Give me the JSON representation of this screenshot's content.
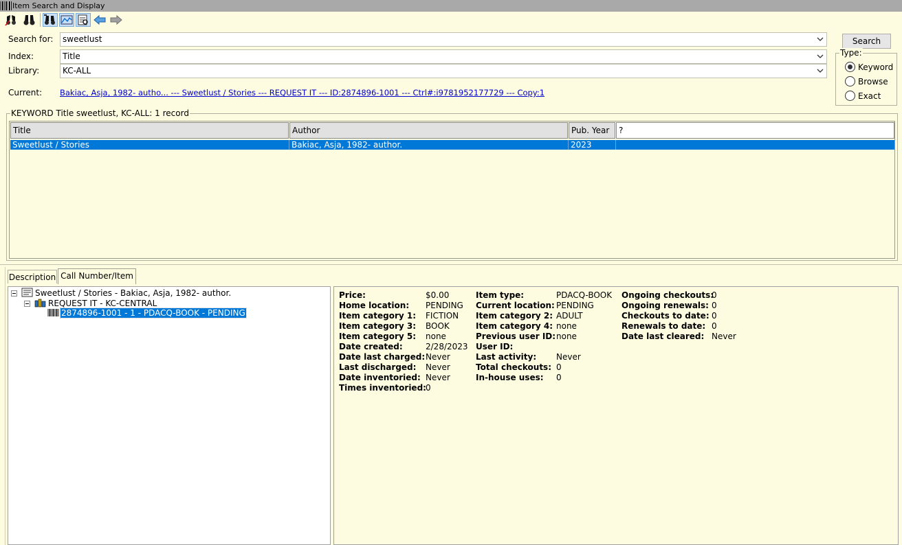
{
  "window": {
    "title": "Item Search and Display"
  },
  "search": {
    "label": "Search for:",
    "value": "sweetlust",
    "button": "Search"
  },
  "index": {
    "label": "Index:",
    "value": "Title"
  },
  "library": {
    "label": "Library:",
    "value": "KC-ALL"
  },
  "type": {
    "label": "Type:",
    "options": [
      "Keyword",
      "Browse",
      "Exact"
    ],
    "selected": "Keyword"
  },
  "current": {
    "label": "Current:",
    "value": "Bakiac, Asja, 1982- autho... --- Sweetlust / Stories --- REQUEST IT --- ID:2874896-1001 --- Ctrl#:i9781952177729 --- Copy:1"
  },
  "results": {
    "caption": "KEYWORD Title sweetlust, KC-ALL: 1 record",
    "columns": [
      "Title",
      "Author",
      "Pub. Year",
      "?"
    ],
    "rows": [
      {
        "title": "Sweetlust / Stories",
        "author": "Bakiac, Asja, 1982- author.",
        "year": "2023"
      }
    ]
  },
  "tabs": [
    "Description",
    "Call Number/Item"
  ],
  "active_tab": "Call Number/Item",
  "tree": {
    "root": "Sweetlust / Stories - Bakiac, Asja, 1982- author.",
    "callnum": "REQUEST IT - KC-CENTRAL",
    "item": "2874896-1001 - 1 - PDACQ-BOOK - PENDING"
  },
  "details": {
    "col1": [
      {
        "k": "Price:",
        "v": "$0.00"
      },
      {
        "k": "Home location:",
        "v": "PENDING"
      },
      {
        "k": "Item category 1:",
        "v": "FICTION"
      },
      {
        "k": "Item category 3:",
        "v": "BOOK"
      },
      {
        "k": "Item category 5:",
        "v": "none"
      },
      {
        "k": "Date created:",
        "v": "2/28/2023"
      },
      {
        "k": "Date last charged:",
        "v": "Never"
      },
      {
        "k": "Last discharged:",
        "v": "Never"
      },
      {
        "k": "Date inventoried:",
        "v": "Never"
      },
      {
        "k": "Times inventoried:",
        "v": "0"
      }
    ],
    "col2": [
      {
        "k": "Item type:",
        "v": "PDACQ-BOOK"
      },
      {
        "k": "Current location:",
        "v": "PENDING"
      },
      {
        "k": "Item category 2:",
        "v": "ADULT"
      },
      {
        "k": "Item category 4:",
        "v": "none"
      },
      {
        "k": "Previous user ID:",
        "v": "none"
      },
      {
        "k": "User ID:",
        "v": ""
      },
      {
        "k": "Last activity:",
        "v": "Never"
      },
      {
        "k": "Total checkouts:",
        "v": "0"
      },
      {
        "k": "In-house uses:",
        "v": "0"
      }
    ],
    "col3": [
      {
        "k": "Ongoing checkouts:",
        "v": "0"
      },
      {
        "k": "Ongoing renewals:",
        "v": "0"
      },
      {
        "k": "Checkouts to date:",
        "v": "0"
      },
      {
        "k": "Renewals to date:",
        "v": "0"
      },
      {
        "k": "Date last cleared:",
        "v": "Never"
      }
    ]
  },
  "icons": {
    "toolbar": [
      "search-binoculars-icon",
      "binoculars-icon",
      "search-helper-icon",
      "display-icon",
      "item-display-icon",
      "back-arrow-icon",
      "forward-arrow-icon"
    ]
  }
}
